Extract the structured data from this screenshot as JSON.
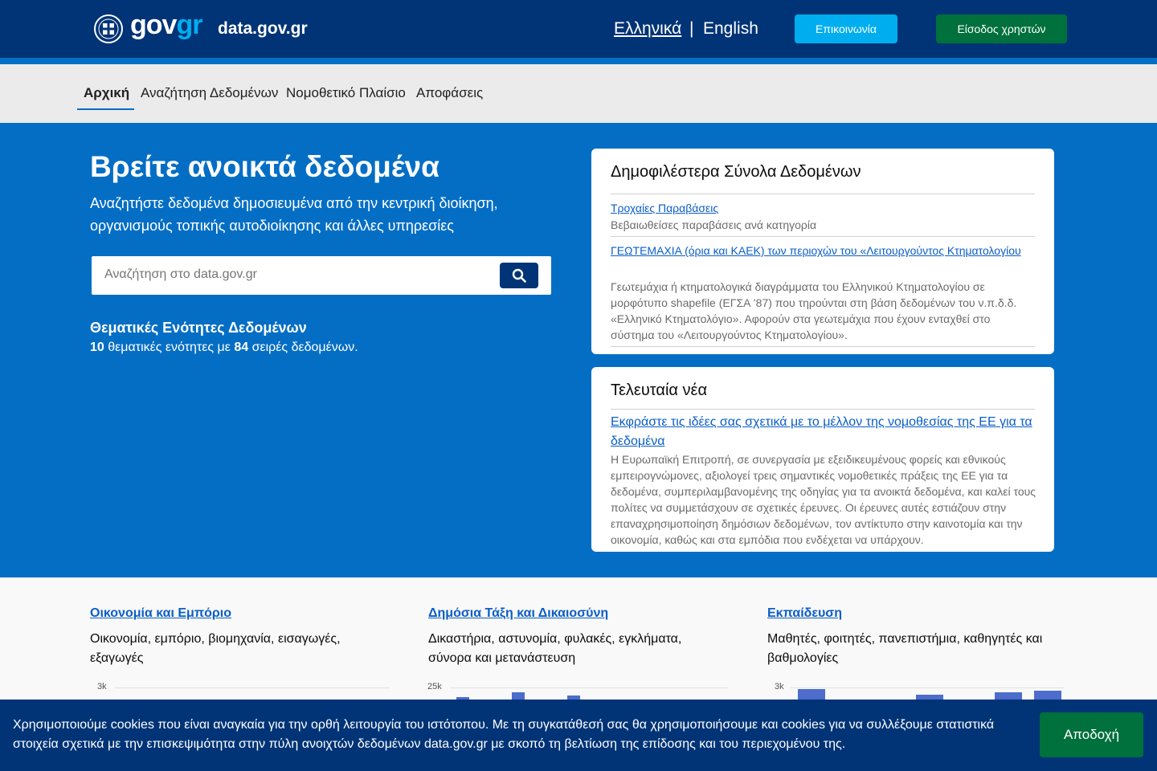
{
  "header": {
    "logo_main": "gov",
    "logo_accent": "gr",
    "site_name": "data.gov.gr",
    "lang_greek": "Ελληνικά",
    "lang_separator": "|",
    "lang_english": "English",
    "contact_label": "Επικοινωνία",
    "login_label": "Είσοδος χρηστών"
  },
  "nav": {
    "items": [
      {
        "label": "Αρχική",
        "active": true
      },
      {
        "label": "Αναζήτηση Δεδομένων",
        "active": false
      },
      {
        "label": "Νομοθετικό Πλαίσιο",
        "active": false
      },
      {
        "label": "Αποφάσεις",
        "active": false
      }
    ]
  },
  "hero": {
    "title": "Βρείτε ανοικτά δεδομένα",
    "subtitle": "Αναζητήστε δεδομένα δημοσιευμένα από την κεντρική διοίκηση, οργανισμούς τοπικής αυτοδιοίκησης και άλλες υπηρεσίες",
    "search_placeholder": "Αναζήτηση στο data.gov.gr",
    "themes_title": "Θεματικές Ενότητες Δεδομένων",
    "themes_count": "10",
    "themes_mid": "θεματικές ενότητες με",
    "series_count": "84",
    "themes_end": "σειρές δεδομένων."
  },
  "popular": {
    "title": "Δημοφιλέστερα Σύνολα Δεδομένων",
    "items": [
      {
        "link": "Τροχαίες Παραβάσεις",
        "desc": "Βεβαιωθείσες παραβάσεις ανά κατηγορία"
      },
      {
        "link": "ΓΕΩΤΕΜΑΧΙΑ (όρια και ΚΑΕΚ) των περιοχών του «Λειτουργούντος Κτηματολογίου",
        "desc": "Γεωτεμάχια ή κτηματολογικά διαγράμματα του Ελληνικού Κτηματολογίου σε μορφότυπο shapefile (ΕΓΣΑ ’87) που τηρούνται στη βάση δεδομένων του ν.π.δ.δ. «Ελληνικό Κτηματολόγιο». Αφορούν στα γεωτεμάχια που έχουν ενταχθεί στο σύστημα του «Λειτουργούντος Κτηματολογίου»."
      }
    ]
  },
  "news": {
    "title": "Τελευταία νέα",
    "link": "Εκφράστε τις ιδέες σας σχετικά με το μέλλον της νομοθεσίας της ΕΕ για τα δεδομένα",
    "desc": "Η Ευρωπαϊκή Επιτροπή, σε συνεργασία με εξειδικευμένους φορείς και εθνικούς εμπειρογνώμονες, αξιολογεί τρεις σημαντικές νομοθετικές πράξεις της ΕΕ για τα δεδομένα, συμπεριλαμβανομένης της οδηγίας για τα ανοικτά δεδομένα, και καλεί τους πολίτες να συμμετάσχουν σε σχετικές έρευνες. Οι έρευνες αυτές εστιάζουν στην επαναχρησιμοποίηση δημόσιων δεδομένων, τον αντίκτυπο στην καινοτομία και την οικονομία, καθώς και στα εμπόδια που ενδέχεται να υπάρχουν."
  },
  "categories": [
    {
      "title": "Οικονομία και Εμπόριο",
      "desc": "Οικονομία, εμπόριο, βιομηχανία, εισαγωγές, εξαγωγές",
      "axis_label": "3k"
    },
    {
      "title": "Δημόσια Τάξη και Δικαιοσύνη",
      "desc": "Δικαστήρια, αστυνομία, φυλακές, εγκλήματα, σύνορα και μετανάστευση",
      "axis_label": "25k"
    },
    {
      "title": "Εκπαίδευση",
      "desc": "Μαθητές, φοιτητές, πανεπιστήμια, καθηγητές και βαθμολογίες",
      "axis_label": "3k"
    }
  ],
  "colors": {
    "header_blue": "#003476",
    "hero_blue": "#046ec5",
    "accent_cyan": "#00aeef",
    "success_green": "#00703c",
    "link_blue": "#0b5ec5"
  },
  "cookie": {
    "text": "Χρησιμοποιούμε cookies που είναι αναγκαία για την ορθή λειτουργία του ιστότοπου. Με τη συγκατάθεσή σας θα χρησιμοποιήσουμε και cookies για να συλλέξουμε στατιστικά στοιχεία σχετικά με την επισκεψιμότητα στην πύλη ανοιχτών δεδομένων data.gov.gr με σκοπό τη βελτίωση της επίδοσης και του περιεχομένου της.",
    "accept_label": "Αποδοχή"
  }
}
